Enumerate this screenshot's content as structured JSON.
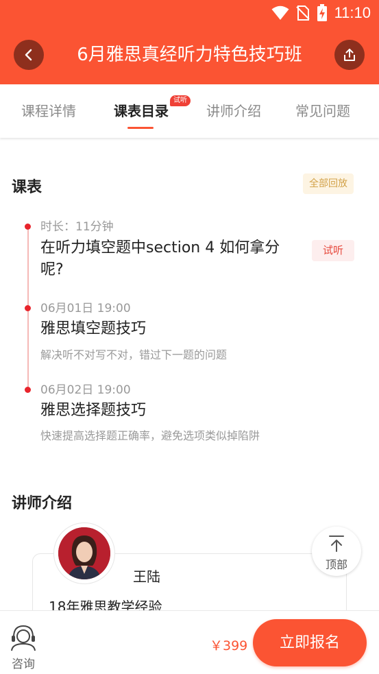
{
  "status_bar": {
    "time": "11:10"
  },
  "header": {
    "title": "6月雅思真经听力特色技巧班"
  },
  "tabs": [
    {
      "label": "课程详情",
      "active": false
    },
    {
      "label": "课表目录",
      "active": true,
      "badge": "试听"
    },
    {
      "label": "讲师介绍",
      "active": false
    },
    {
      "label": "常见问题",
      "active": false
    }
  ],
  "schedule": {
    "title": "课表",
    "replay_badge": "全部回放",
    "lessons": [
      {
        "meta": "时长：11分钟",
        "title_line1": "在听力填空题中section 4 如何拿分",
        "title_line2": "呢?",
        "badge": "试听"
      },
      {
        "meta": "06月01日 19:00",
        "title": "雅思填空题技巧",
        "desc": "解决听不对写不对，错过下一题的问题"
      },
      {
        "meta": "06月02日 19:00",
        "title": "雅思选择题技巧",
        "desc": "快速提高选择题正确率，避免选项类似掉陷阱"
      }
    ]
  },
  "teacher": {
    "section_title": "讲师介绍",
    "name": "王陆",
    "experience": "18年雅思教学经验"
  },
  "back_to_top": {
    "label": "顶部"
  },
  "bottom_bar": {
    "consult_label": "咨询",
    "price": "￥399",
    "enroll_label": "立即报名"
  },
  "colors": {
    "brand": "#fb5433",
    "timeline_dot": "#e8242c"
  },
  "icons": [
    "back-arrow-icon",
    "share-icon",
    "wifi-icon",
    "no-sim-icon",
    "battery-charging-icon",
    "arrow-up-icon",
    "headset-icon"
  ]
}
